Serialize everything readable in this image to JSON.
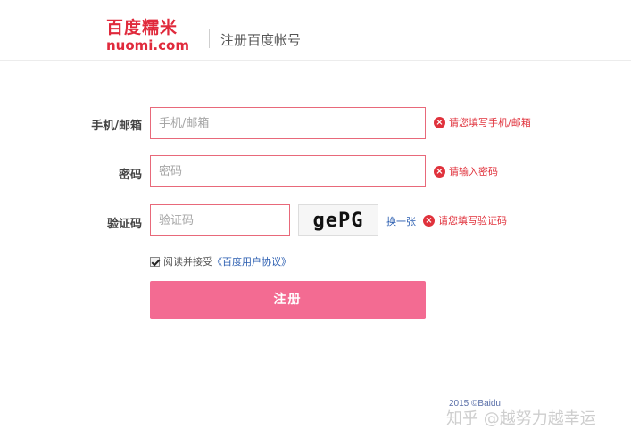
{
  "header": {
    "logo_cn": "百度糯米",
    "logo_en": "nuomi.com",
    "title": "注册百度帐号"
  },
  "form": {
    "phone": {
      "label": "手机/邮箱",
      "placeholder": "手机/邮箱",
      "error": "请您填写手机/邮箱"
    },
    "password": {
      "label": "密码",
      "placeholder": "密码",
      "error": "请输入密码"
    },
    "captcha": {
      "label": "验证码",
      "placeholder": "验证码",
      "image_text": "gePG",
      "swap_label": "换一张",
      "error": "请您填写验证码"
    },
    "agreement": {
      "checked": true,
      "text": "阅读并接受",
      "link": "《百度用户协议》"
    },
    "submit_label": "注册"
  },
  "footer": {
    "copyright": "2015 ©Baidu",
    "watermark": "知乎 @越努力越幸运"
  },
  "colors": {
    "brand": "#e02a3c",
    "error": "#e0323c",
    "submit": "#f36b92",
    "link": "#2a5db0"
  },
  "icons": {
    "error": "error-x-circle-icon",
    "checkbox": "checkbox-checked-icon"
  }
}
